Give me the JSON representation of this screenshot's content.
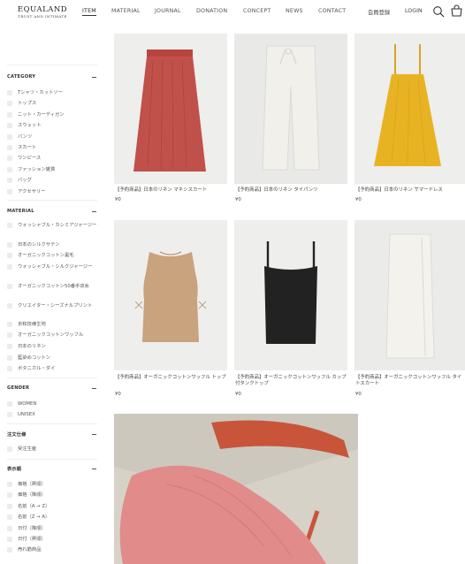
{
  "header": {
    "logo_main": "EQUALAND",
    "logo_sub": "TRUST AND INTIMATE",
    "nav": [
      "ITEM",
      "MATERIAL",
      "JOURNAL",
      "DONATION",
      "CONCEPT",
      "NEWS",
      "CONTACT"
    ],
    "member": "会員登録",
    "login": "LOGIN",
    "icons": [
      "search-icon",
      "cart-icon"
    ]
  },
  "sidebar": {
    "category": {
      "title": "CATEGORY",
      "items": [
        "Tシャツ・カットソー",
        "トップス",
        "ニット・カーディガン",
        "スウェット",
        "パンツ",
        "スカート",
        "ワンピース",
        "ファッション雑貨",
        "バッグ",
        "アクセサリー"
      ]
    },
    "material": {
      "title": "MATERIAL",
      "items": [
        "ウォッシャブル・カシミアジャージー",
        "日本のシルクサテン",
        "オーガニックコットン裏毛",
        "ウォッシャブル・シルクジャージー",
        "オーガニックコットン50番手双糸",
        "クリエイター・シーズナルプリント",
        "京和技様生地",
        "オーガニックコットンワッフル",
        "日本のリネン",
        "藍染めコットン",
        "ボタニカル・ダイ"
      ]
    },
    "gender": {
      "title": "GENDER",
      "items": [
        "WOMEN",
        "UNISEX"
      ]
    },
    "order": {
      "title": "注文仕様",
      "items": [
        "受注生産"
      ]
    },
    "sort": {
      "title": "表示順",
      "items": [
        "価格（昇順）",
        "価格（降順）",
        "名前（A → Z）",
        "名前（Z → A）",
        "日付（降順）",
        "日付（昇順）",
        "売れ筋商品"
      ]
    }
  },
  "products": [
    {
      "title": "【予約商品】日本のリネン マキシスカート",
      "price": "¥0",
      "color": "#c0504a"
    },
    {
      "title": "【予約商品】日本のリネン タイパンツ",
      "price": "¥0",
      "color": "#f2f0ea"
    },
    {
      "title": "【予約商品】日本のリネン サマードレス",
      "price": "¥0",
      "color": "#e8b323"
    },
    {
      "title": "【予約商品】オーガニックコットンワッフル トップ",
      "price": "¥0",
      "color": "#c9a27e"
    },
    {
      "title": "【予約商品】オーガニックコットンワッフル カップ付タンクトップ",
      "price": "¥0",
      "color": "#222222"
    },
    {
      "title": "【予約商品】オーガニックコットンワッフル タイトスカート",
      "price": "¥0",
      "color": "#f4f2ec"
    }
  ],
  "colors": {
    "lifestyle_bg": "#d6d2c8",
    "lifestyle_fabric": "#e28b8b",
    "lifestyle_chair": "#c8553a"
  }
}
